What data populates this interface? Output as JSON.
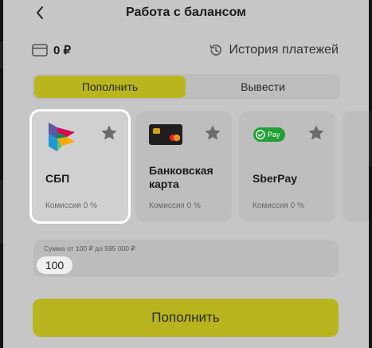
{
  "header": {
    "title": "Работа с балансом"
  },
  "balance": {
    "value": "0 ₽",
    "history_label": "История платежей"
  },
  "tabs": [
    {
      "label": "Пополнить",
      "active": true
    },
    {
      "label": "Вывести",
      "active": false
    }
  ],
  "methods": [
    {
      "label": "СБП",
      "fee": "Комиссия 0 %",
      "selected": true,
      "icon": "sbp-logo"
    },
    {
      "label": "Банковская карта",
      "fee": "Комиссия 0 %",
      "selected": false,
      "icon": "bank-card-icon"
    },
    {
      "label": "SberPay",
      "fee": "Комиссия 0 %",
      "selected": false,
      "icon": "sberpay-logo",
      "badge": "Pay"
    }
  ],
  "amount": {
    "hint": "Сумма от 100 ₽ до 595 000 ₽",
    "value": "100"
  },
  "submit_label": "Пополнить",
  "colors": {
    "accent": "#b8b51e",
    "background": "#c6c6c6",
    "card": "#bebebe"
  }
}
